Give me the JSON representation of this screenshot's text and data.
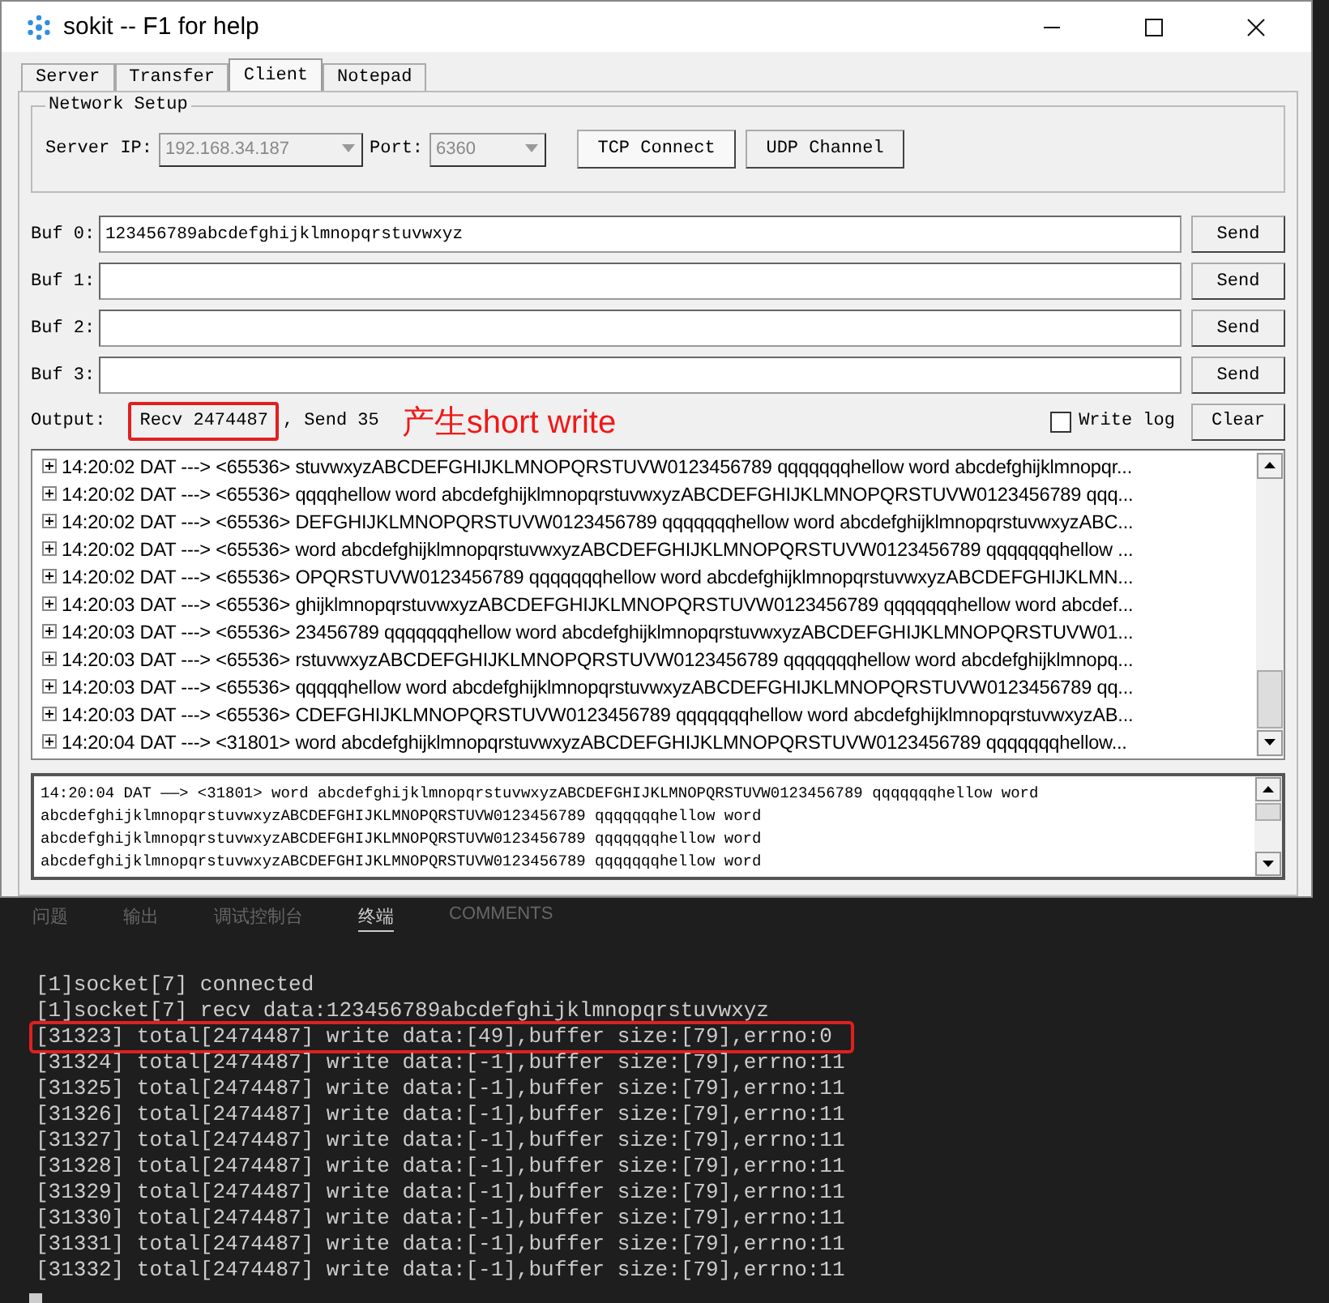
{
  "window": {
    "title": "sokit -- F1 for help"
  },
  "tabs": [
    {
      "label": "Server",
      "selected": false
    },
    {
      "label": "Transfer",
      "selected": false
    },
    {
      "label": "Client",
      "selected": true
    },
    {
      "label": "Notepad",
      "selected": false
    }
  ],
  "network_setup": {
    "title": "Network Setup",
    "server_ip_label": "Server IP:",
    "server_ip": "192.168.34.187",
    "port_label": "Port:",
    "port": "6360",
    "disabled": true,
    "buttons": [
      "TCP Connect",
      "UDP Channel"
    ]
  },
  "buffers": [
    {
      "label": "Buf 0:",
      "value": "123456789abcdefghijklmnopqrstuvwxyz",
      "button": "Send"
    },
    {
      "label": "Buf 1:",
      "button": "Send"
    },
    {
      "label": "Buf 2:",
      "button": "Send"
    },
    {
      "label": "Buf 3:",
      "button": "Send"
    }
  ],
  "output": {
    "label": "Output:",
    "recv": "Recv 2474487",
    "recv_highlighted": true,
    "send": ", Send 35",
    "annotation": "产生short write",
    "write_log": {
      "label": "Write log",
      "checked": false
    },
    "clear": "Clear"
  },
  "log_rows": [
    {
      "time": "14:20:02",
      "type": "DAT",
      "arrow": "--->",
      "size": "<65536>",
      "data": "stuvwxyzABCDEFGHIJKLMNOPQRSTUVW0123456789 qqqqqqqhellow word abcdefghijklmnopqr..."
    },
    {
      "time": "14:20:02",
      "type": "DAT",
      "arrow": "--->",
      "size": "<65536>",
      "data": "qqqqhellow word abcdefghijklmnopqrstuvwxyzABCDEFGHIJKLMNOPQRSTUVW0123456789 qqq..."
    },
    {
      "time": "14:20:02",
      "type": "DAT",
      "arrow": "--->",
      "size": "<65536>",
      "data": "DEFGHIJKLMNOPQRSTUVW0123456789 qqqqqqqhellow word abcdefghijklmnopqrstuvwxyzABC..."
    },
    {
      "time": "14:20:02",
      "type": "DAT",
      "arrow": "--->",
      "size": "<65536>",
      "data": "word abcdefghijklmnopqrstuvwxyzABCDEFGHIJKLMNOPQRSTUVW0123456789 qqqqqqqhellow ..."
    },
    {
      "time": "14:20:02",
      "type": "DAT",
      "arrow": "--->",
      "size": "<65536>",
      "data": "OPQRSTUVW0123456789 qqqqqqqhellow word abcdefghijklmnopqrstuvwxyzABCDEFGHIJKLMN..."
    },
    {
      "time": "14:20:03",
      "type": "DAT",
      "arrow": "--->",
      "size": "<65536>",
      "data": "ghijklmnopqrstuvwxyzABCDEFGHIJKLMNOPQRSTUVW0123456789 qqqqqqqhellow word abcdef..."
    },
    {
      "time": "14:20:03",
      "type": "DAT",
      "arrow": "--->",
      "size": "<65536>",
      "data": "23456789 qqqqqqqhellow word abcdefghijklmnopqrstuvwxyzABCDEFGHIJKLMNOPQRSTUVW01..."
    },
    {
      "time": "14:20:03",
      "type": "DAT",
      "arrow": "--->",
      "size": "<65536>",
      "data": "rstuvwxyzABCDEFGHIJKLMNOPQRSTUVW0123456789 qqqqqqqhellow word abcdefghijklmnopq..."
    },
    {
      "time": "14:20:03",
      "type": "DAT",
      "arrow": "--->",
      "size": "<65536>",
      "data": "qqqqqhellow word abcdefghijklmnopqrstuvwxyzABCDEFGHIJKLMNOPQRSTUVW0123456789 qq..."
    },
    {
      "time": "14:20:03",
      "type": "DAT",
      "arrow": "--->",
      "size": "<65536>",
      "data": "CDEFGHIJKLMNOPQRSTUVW0123456789 qqqqqqqhellow word abcdefghijklmnopqrstuvwxyzAB..."
    },
    {
      "time": "14:20:04",
      "type": "DAT",
      "arrow": "--->",
      "size": "<31801>",
      "data": "word abcdefghijklmnopqrstuvwxyzABCDEFGHIJKLMNOPQRSTUVW0123456789 qqqqqqqhellow..."
    }
  ],
  "detail_lines": [
    "14:20:04 DAT ——> <31801>  word abcdefghijklmnopqrstuvwxyzABCDEFGHIJKLMNOPQRSTUVW0123456789 qqqqqqqhellow word",
    "abcdefghijklmnopqrstuvwxyzABCDEFGHIJKLMNOPQRSTUVW0123456789 qqqqqqqhellow word",
    "abcdefghijklmnopqrstuvwxyzABCDEFGHIJKLMNOPQRSTUVW0123456789 qqqqqqqhellow word",
    "abcdefghijklmnopqrstuvwxyzABCDEFGHIJKLMNOPQRSTUVW0123456789 qqqqqqqhellow word"
  ],
  "panel_tabs": [
    {
      "label": "问题",
      "selected": false
    },
    {
      "label": "输出",
      "selected": false
    },
    {
      "label": "调试控制台",
      "selected": false
    },
    {
      "label": "终端",
      "selected": true
    },
    {
      "label": "COMMENTS",
      "selected": false
    }
  ],
  "terminal": [
    {
      "text": "[1]socket[7] connected",
      "highlighted": false
    },
    {
      "text": "[1]socket[7] recv data:123456789abcdefghijklmnopqrstuvwxyz",
      "highlighted": false
    },
    {
      "text": "[31323] total[2474487] write data:[49],buffer size:[79],errno:0",
      "highlighted": true
    },
    {
      "text": "[31324] total[2474487] write data:[-1],buffer size:[79],errno:11",
      "highlighted": false
    },
    {
      "text": "[31325] total[2474487] write data:[-1],buffer size:[79],errno:11",
      "highlighted": false
    },
    {
      "text": "[31326] total[2474487] write data:[-1],buffer size:[79],errno:11",
      "highlighted": false
    },
    {
      "text": "[31327] total[2474487] write data:[-1],buffer size:[79],errno:11",
      "highlighted": false
    },
    {
      "text": "[31328] total[2474487] write data:[-1],buffer size:[79],errno:11",
      "highlighted": false
    },
    {
      "text": "[31329] total[2474487] write data:[-1],buffer size:[79],errno:11",
      "highlighted": false
    },
    {
      "text": "[31330] total[2474487] write data:[-1],buffer size:[79],errno:11",
      "highlighted": false
    },
    {
      "text": "[31331] total[2474487] write data:[-1],buffer size:[79],errno:11",
      "highlighted": false
    },
    {
      "text": "[31332] total[2474487] write data:[-1],buffer size:[79],errno:11",
      "highlighted": false
    }
  ]
}
